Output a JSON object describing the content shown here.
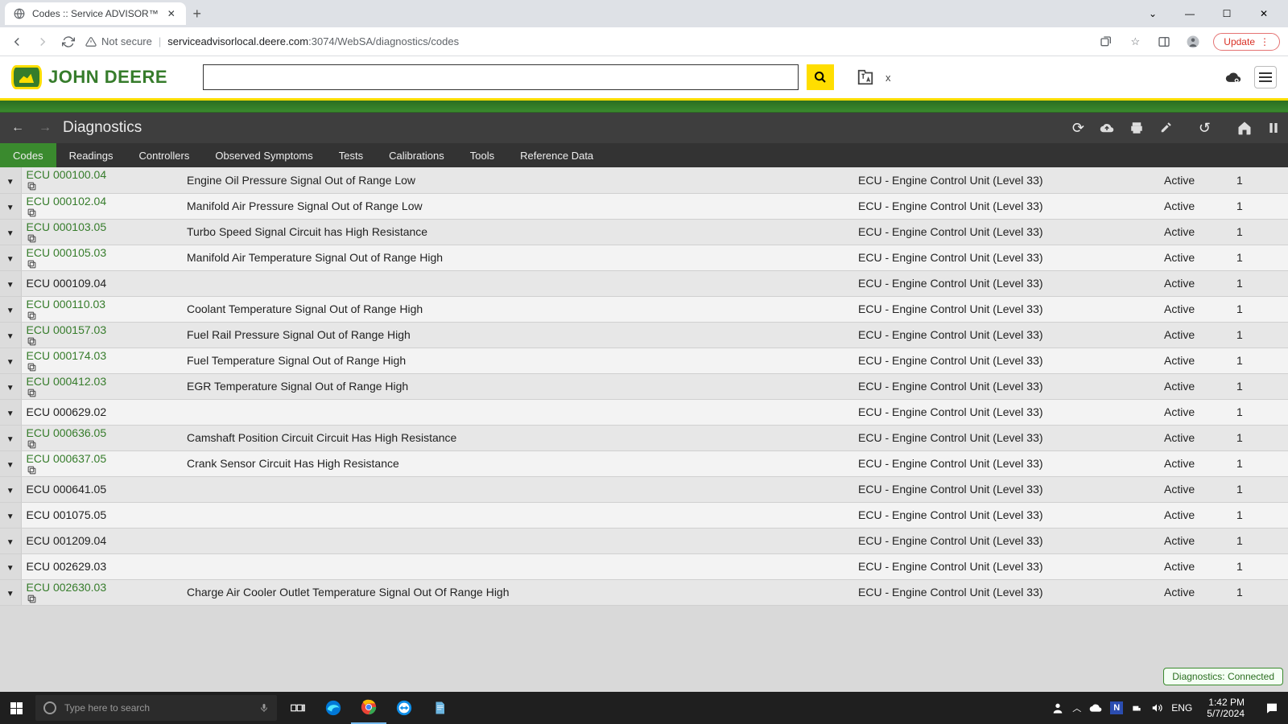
{
  "browser": {
    "tab_title": "Codes :: Service ADVISOR™",
    "url_host": "serviceadvisorlocal.deere.com",
    "url_port": ":3074",
    "url_path": "/WebSA/diagnostics/codes",
    "not_secure": "Not secure",
    "update": "Update"
  },
  "app": {
    "brand": "JOHN DEERE",
    "search_value": "",
    "header_x": "x",
    "page_title": "Diagnostics",
    "menu": [
      "Codes",
      "Readings",
      "Controllers",
      "Observed Symptoms",
      "Tests",
      "Calibrations",
      "Tools",
      "Reference Data"
    ],
    "active_menu": 0,
    "status_badge": "Diagnostics: Connected"
  },
  "cols": {
    "status": "Active"
  },
  "rows": [
    {
      "code": "ECU 000100.04",
      "link": true,
      "copy": true,
      "desc": "Engine Oil Pressure Signal Out of Range Low",
      "ctrl": "ECU - Engine Control Unit (Level 33)",
      "status": "Active",
      "count": "1"
    },
    {
      "code": "ECU 000102.04",
      "link": true,
      "copy": true,
      "desc": "Manifold Air Pressure Signal Out of Range Low",
      "ctrl": "ECU - Engine Control Unit (Level 33)",
      "status": "Active",
      "count": "1"
    },
    {
      "code": "ECU 000103.05",
      "link": true,
      "copy": true,
      "desc": "Turbo Speed Signal Circuit has High Resistance",
      "ctrl": "ECU - Engine Control Unit (Level 33)",
      "status": "Active",
      "count": "1"
    },
    {
      "code": "ECU 000105.03",
      "link": true,
      "copy": true,
      "desc": "Manifold Air Temperature Signal Out of Range High",
      "ctrl": "ECU - Engine Control Unit (Level 33)",
      "status": "Active",
      "count": "1"
    },
    {
      "code": "ECU 000109.04",
      "link": false,
      "copy": false,
      "desc": "",
      "ctrl": "ECU - Engine Control Unit (Level 33)",
      "status": "Active",
      "count": "1"
    },
    {
      "code": "ECU 000110.03",
      "link": true,
      "copy": true,
      "desc": "Coolant Temperature Signal Out of Range High",
      "ctrl": "ECU - Engine Control Unit (Level 33)",
      "status": "Active",
      "count": "1"
    },
    {
      "code": "ECU 000157.03",
      "link": true,
      "copy": true,
      "desc": "Fuel Rail Pressure Signal Out of Range High",
      "ctrl": "ECU - Engine Control Unit (Level 33)",
      "status": "Active",
      "count": "1"
    },
    {
      "code": "ECU 000174.03",
      "link": true,
      "copy": true,
      "desc": "Fuel Temperature Signal Out of Range High",
      "ctrl": "ECU - Engine Control Unit (Level 33)",
      "status": "Active",
      "count": "1"
    },
    {
      "code": "ECU 000412.03",
      "link": true,
      "copy": true,
      "desc": "EGR Temperature Signal Out of Range High",
      "ctrl": "ECU - Engine Control Unit (Level 33)",
      "status": "Active",
      "count": "1"
    },
    {
      "code": "ECU 000629.02",
      "link": false,
      "copy": false,
      "desc": "",
      "ctrl": "ECU - Engine Control Unit (Level 33)",
      "status": "Active",
      "count": "1"
    },
    {
      "code": "ECU 000636.05",
      "link": true,
      "copy": true,
      "desc": "Camshaft Position Circuit Circuit Has High Resistance",
      "ctrl": "ECU - Engine Control Unit (Level 33)",
      "status": "Active",
      "count": "1"
    },
    {
      "code": "ECU 000637.05",
      "link": true,
      "copy": true,
      "desc": "Crank Sensor Circuit Has High Resistance",
      "ctrl": "ECU - Engine Control Unit (Level 33)",
      "status": "Active",
      "count": "1"
    },
    {
      "code": "ECU 000641.05",
      "link": false,
      "copy": false,
      "desc": "",
      "ctrl": "ECU - Engine Control Unit (Level 33)",
      "status": "Active",
      "count": "1"
    },
    {
      "code": "ECU 001075.05",
      "link": false,
      "copy": false,
      "desc": "",
      "ctrl": "ECU - Engine Control Unit (Level 33)",
      "status": "Active",
      "count": "1"
    },
    {
      "code": "ECU 001209.04",
      "link": false,
      "copy": false,
      "desc": "",
      "ctrl": "ECU - Engine Control Unit (Level 33)",
      "status": "Active",
      "count": "1"
    },
    {
      "code": "ECU 002629.03",
      "link": false,
      "copy": false,
      "desc": "",
      "ctrl": "ECU - Engine Control Unit (Level 33)",
      "status": "Active",
      "count": "1"
    },
    {
      "code": "ECU 002630.03",
      "link": true,
      "copy": true,
      "desc": "Charge Air Cooler Outlet Temperature Signal Out Of Range High",
      "ctrl": "ECU - Engine Control Unit (Level 33)",
      "status": "Active",
      "count": "1"
    }
  ],
  "taskbar": {
    "search_placeholder": "Type here to search",
    "lang": "ENG",
    "time": "1:42 PM",
    "date": "5/7/2024"
  }
}
